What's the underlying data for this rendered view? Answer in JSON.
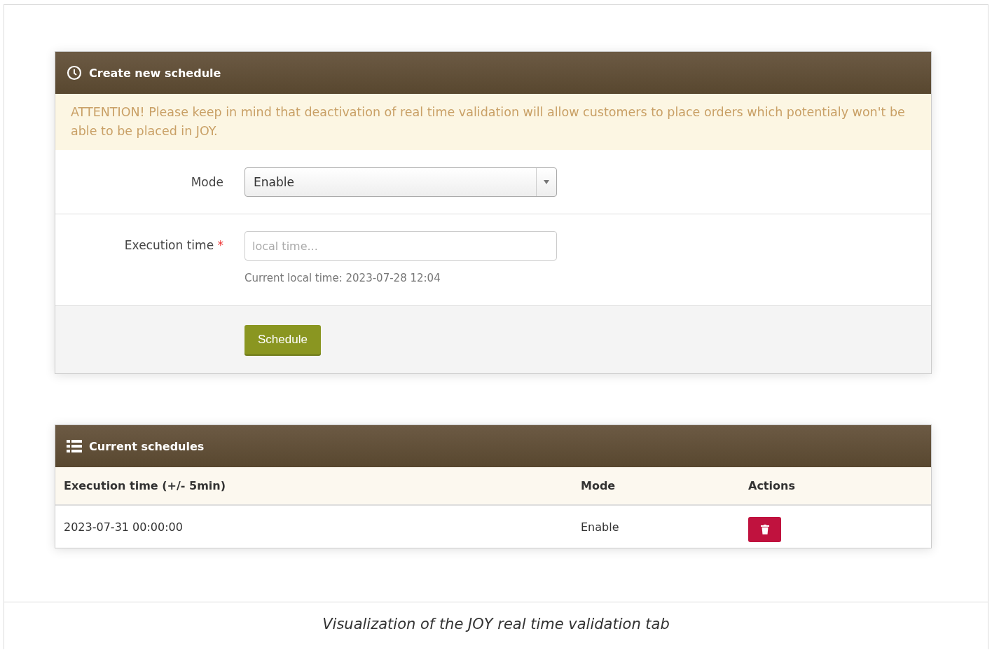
{
  "create_panel": {
    "title": "Create new schedule",
    "alert": "ATTENTION! Please keep in mind that deactivation of real time validation will allow customers to place orders which potentialy won't be able to be placed in JOY.",
    "mode": {
      "label": "Mode",
      "value": "Enable"
    },
    "execution_time": {
      "label": "Execution time",
      "required_mark": "*",
      "placeholder": "local time...",
      "help": "Current local time: 2023-07-28 12:04"
    },
    "button": "Schedule"
  },
  "schedules_panel": {
    "title": "Current schedules",
    "columns": [
      "Execution time (+/- 5min)",
      "Mode",
      "Actions"
    ],
    "rows": [
      {
        "execution_time": "2023-07-31 00:00:00",
        "mode": "Enable"
      }
    ]
  },
  "caption": "Visualization of the JOY real time validation tab"
}
